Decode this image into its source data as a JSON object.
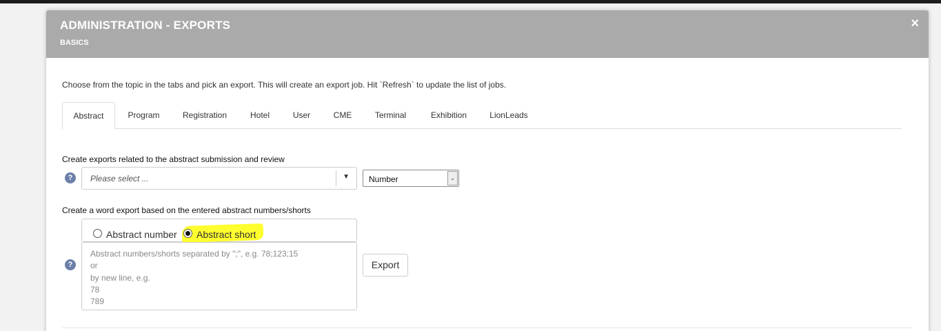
{
  "modal": {
    "title": "ADMINISTRATION - EXPORTS",
    "subtitle": "BASICS",
    "close_label": "×"
  },
  "intro_text": "Choose from the topic in the tabs and pick an export. This will create an export job. Hit `Refresh` to update the list of jobs.",
  "tabs": [
    {
      "label": "Abstract",
      "active": true
    },
    {
      "label": "Program",
      "active": false
    },
    {
      "label": "Registration",
      "active": false
    },
    {
      "label": "Hotel",
      "active": false
    },
    {
      "label": "User",
      "active": false
    },
    {
      "label": "CME",
      "active": false
    },
    {
      "label": "Terminal",
      "active": false
    },
    {
      "label": "Exhibition",
      "active": false
    },
    {
      "label": "LionLeads",
      "active": false
    }
  ],
  "abstract_exports": {
    "label": "Create exports related to the abstract submission and review",
    "help_icon": "question-circle-icon",
    "help_glyph": "?",
    "select_placeholder": "Please select ...",
    "caret_glyph": "▼",
    "sort_select": "Number",
    "sort_caret_glyph": "⌄"
  },
  "word_export": {
    "label": "Create a word export based on the entered abstract numbers/shorts",
    "help_glyph": "?",
    "radio_options": [
      {
        "label": "Abstract number",
        "checked": false
      },
      {
        "label": "Abstract short",
        "checked": true
      }
    ],
    "highlight_color": "#fffe2e",
    "textarea_placeholder": "Abstract numbers/shorts separated by \";\", e.g. 78;123;15\nor\nby new line, e.g.\n78\n789",
    "export_button": "Export"
  },
  "colors": {
    "header_bg": "#aaaaaa",
    "help_icon": "#6b7fa8"
  }
}
